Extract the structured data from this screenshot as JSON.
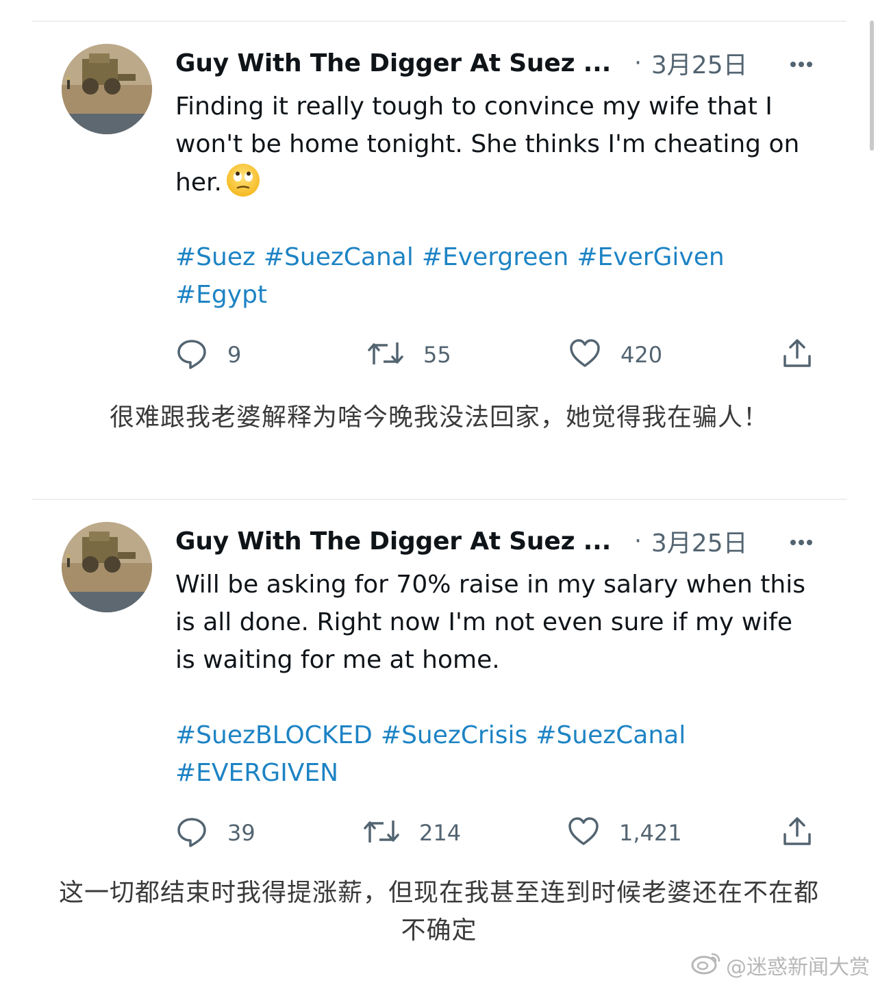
{
  "tweets": [
    {
      "author": "Guy With The Digger At Suez ...",
      "separator": "·",
      "date": "3月25日",
      "text": "Finding it really tough to convince my wife that I\nwon't be home tonight. She thinks I'm cheating on\nher.",
      "emoji": "face-with-rolling-eyes",
      "hashtags": [
        "#Suez",
        "#SuezCanal",
        "#Evergreen",
        "#EverGiven",
        "#Egypt"
      ],
      "replies": "9",
      "retweets": "55",
      "likes": "420"
    },
    {
      "author": "Guy With The Digger At Suez ...",
      "separator": "·",
      "date": "3月25日",
      "text": "Will be asking for 70% raise in my salary when this\nis all done. Right now I'm not even sure if my wife\nis waiting for me at home.",
      "hashtags": [
        "#SuezBLOCKED",
        "#SuezCrisis",
        "#SuezCanal",
        "#EVERGIVEN"
      ],
      "replies": "39",
      "retweets": "214",
      "likes": "1,421"
    }
  ],
  "captions": [
    "很难跟我老婆解释为啥今晚我没法回家，她觉得我在骗人！",
    "这一切都结束时我得提涨薪，但现在我甚至连到时候老婆还在不在都\n不确定"
  ],
  "watermark": "@迷惑新闻大赏",
  "colors": {
    "hashtag": "#1d83c4",
    "secondary_text": "#536471",
    "divider": "#eceff1"
  }
}
